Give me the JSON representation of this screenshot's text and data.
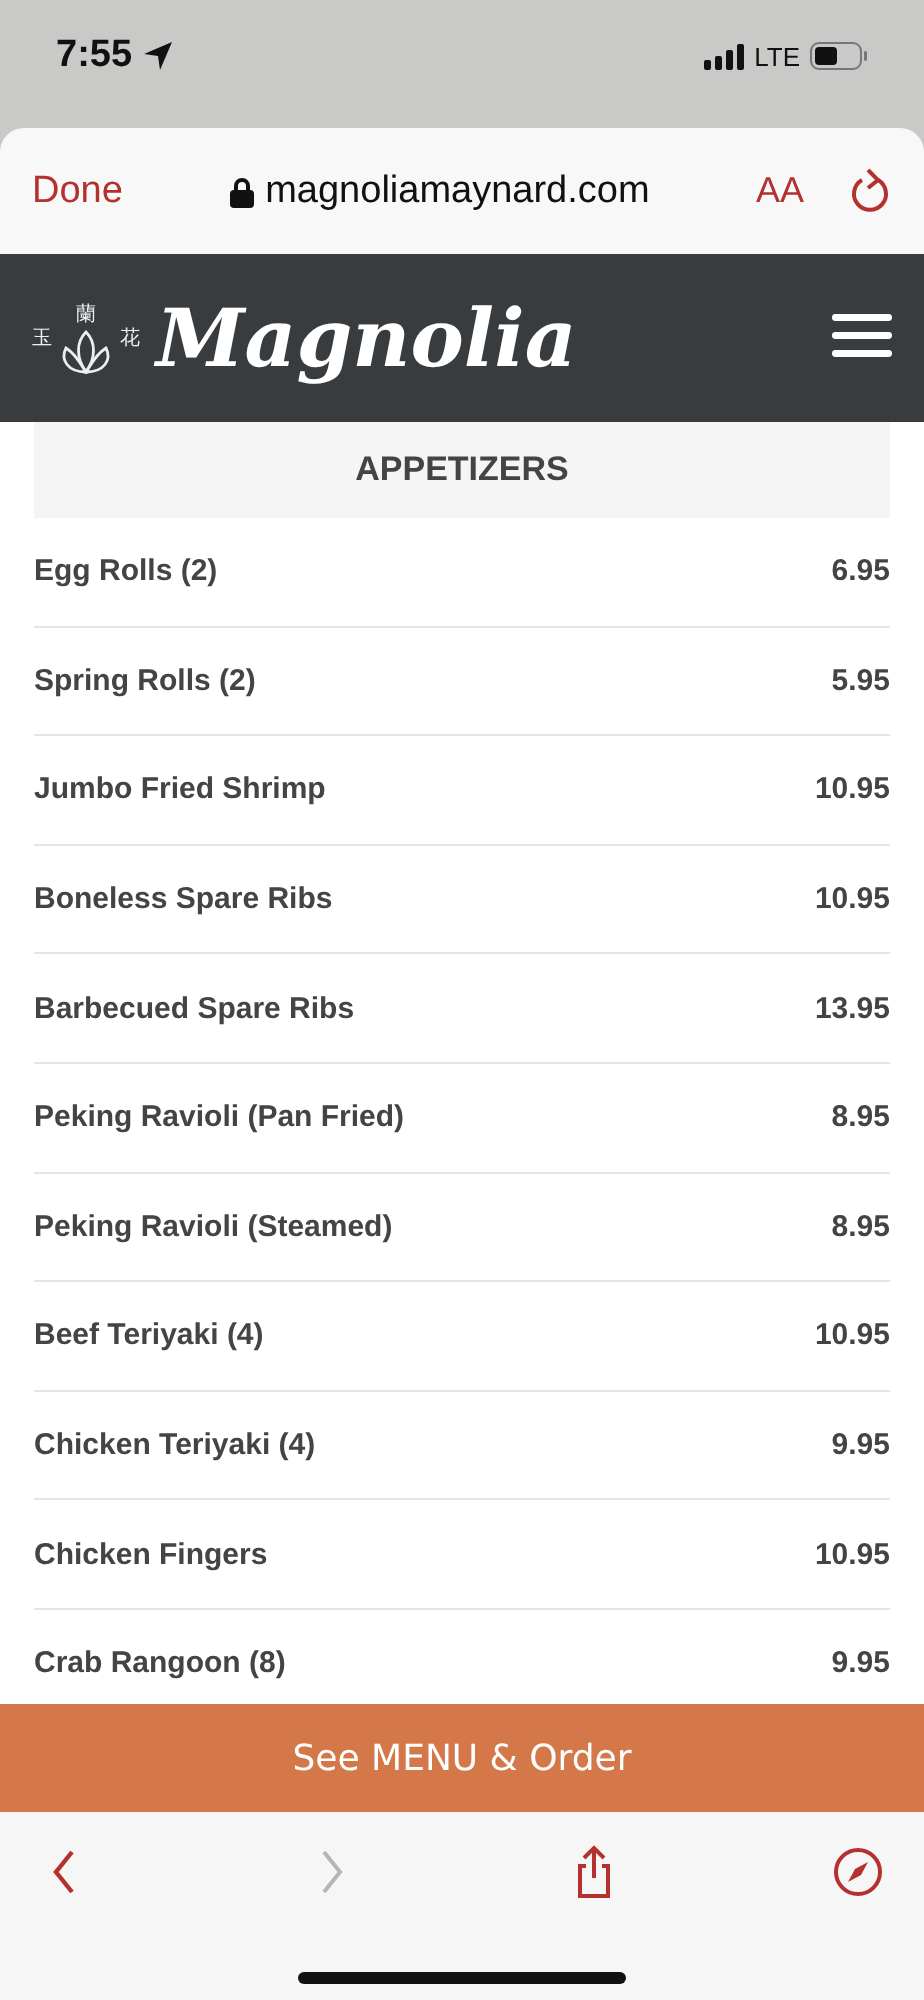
{
  "status_bar": {
    "time": "7:55",
    "network": "LTE"
  },
  "browser_bar": {
    "done": "Done",
    "url": "magnoliamaynard.com",
    "text_size": "AA"
  },
  "site_header": {
    "logo_chars": [
      "玉",
      "蘭",
      "花"
    ],
    "logo_text": "Magnolia"
  },
  "section": {
    "title": "APPETIZERS"
  },
  "menu_items": [
    {
      "name": "Egg Rolls (2)",
      "price": "6.95"
    },
    {
      "name": "Spring Rolls (2)",
      "price": "5.95"
    },
    {
      "name": "Jumbo Fried Shrimp",
      "price": "10.95"
    },
    {
      "name": "Boneless Spare Ribs",
      "price": "10.95"
    },
    {
      "name": "Barbecued Spare Ribs",
      "price": "13.95"
    },
    {
      "name": "Peking Ravioli (Pan Fried)",
      "price": "8.95"
    },
    {
      "name": "Peking Ravioli (Steamed)",
      "price": "8.95"
    },
    {
      "name": "Beef Teriyaki (4)",
      "price": "10.95"
    },
    {
      "name": "Chicken Teriyaki (4)",
      "price": "9.95"
    },
    {
      "name": "Chicken Fingers",
      "price": "10.95"
    },
    {
      "name": "Crab Rangoon (8)",
      "price": "9.95"
    }
  ],
  "order_button": "See MENU & Order",
  "toolbar": [
    {
      "kind": "back",
      "disabled": false
    },
    {
      "kind": "forward",
      "disabled": true
    },
    {
      "kind": "share",
      "disabled": false
    },
    {
      "kind": "compass",
      "disabled": false
    }
  ]
}
